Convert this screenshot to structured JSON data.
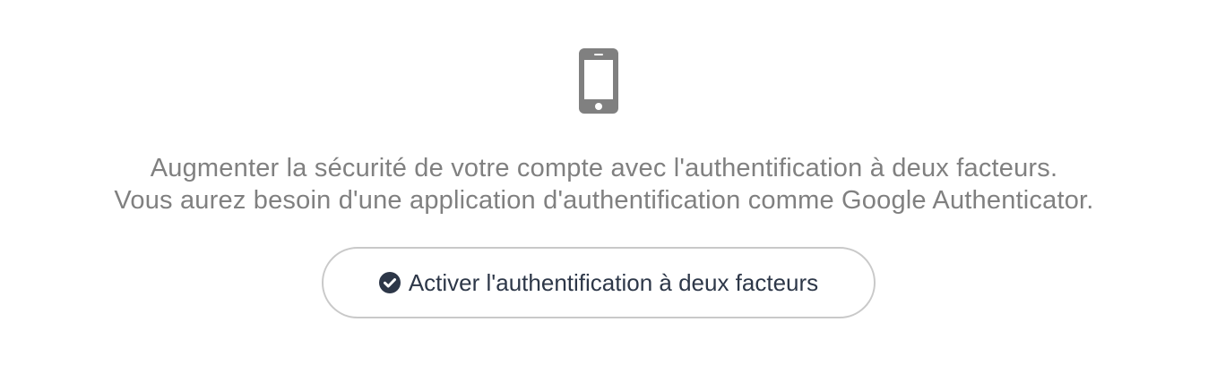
{
  "two_factor": {
    "icon": "mobile-phone-icon",
    "line1": "Augmenter la sécurité de votre compte avec l'authentification à deux facteurs.",
    "line2": "Vous aurez besoin d'une application d'authentification comme Google Authenticator.",
    "button": {
      "icon": "check-circle-icon",
      "label": "Activer l'authentification à deux facteurs"
    }
  },
  "colors": {
    "icon_gray": "#808080",
    "text_gray": "#808080",
    "button_text": "#2d3748",
    "button_border": "#c9c9c9"
  }
}
